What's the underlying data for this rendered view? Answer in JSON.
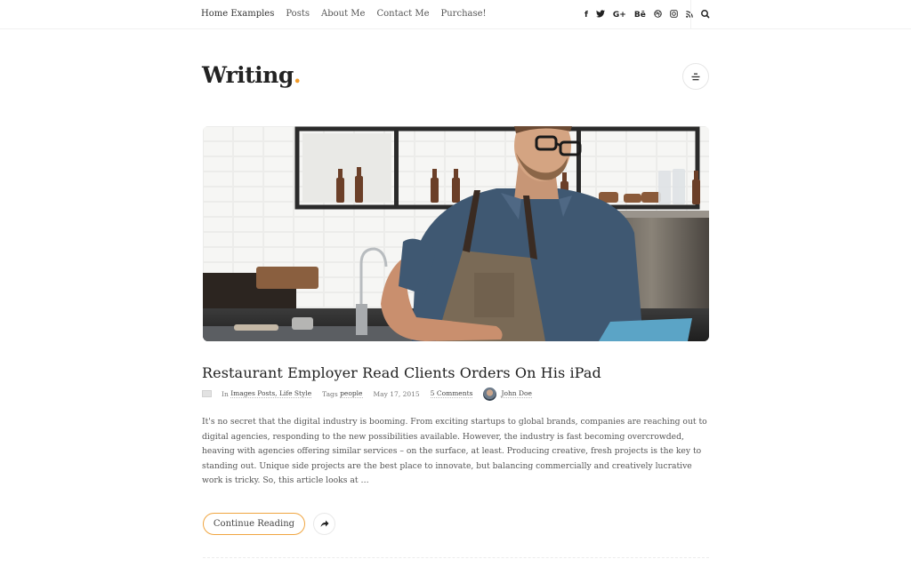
{
  "nav": {
    "items": [
      {
        "label": "Home Examples",
        "active": true
      },
      {
        "label": "Posts",
        "active": false
      },
      {
        "label": "About Me",
        "active": false
      },
      {
        "label": "Contact Me",
        "active": false
      },
      {
        "label": "Purchase!",
        "active": false
      }
    ],
    "social": [
      {
        "icon": "facebook-icon",
        "glyph": "f"
      },
      {
        "icon": "twitter-icon",
        "glyph": "🐦"
      },
      {
        "icon": "google-plus-icon",
        "glyph": "G+"
      },
      {
        "icon": "behance-icon",
        "glyph": "Bē"
      },
      {
        "icon": "dribbble-icon",
        "glyph": "◎"
      },
      {
        "icon": "instagram-icon",
        "glyph": "◙"
      },
      {
        "icon": "rss-icon",
        "glyph": "⩘"
      }
    ],
    "search_icon": "search-icon"
  },
  "header": {
    "title": "Writing",
    "title_dot": ".",
    "menu_icon": "menu-icon"
  },
  "colors": {
    "accent": "#f39c2a",
    "text": "#222222",
    "muted": "#777777"
  },
  "post": {
    "image_alt": "Man in apron reading orders on iPad in a restaurant",
    "title": "Restaurant Employer Read Clients Orders On His iPad",
    "meta": {
      "format_icon": "image-format-icon",
      "in_label": "In",
      "categories": "Images Posts, Life Style",
      "tags_label": "Tags",
      "tags": "people",
      "date": "May 17, 2015",
      "comments": "5 Comments",
      "author": "John Doe"
    },
    "excerpt": "It's no secret that the digital industry is booming. From exciting startups to global brands, companies are reaching out to digital agencies, responding to the new possibilities available. However, the industry is fast becoming overcrowded, heaving with agencies offering similar services – on the surface, at least. Producing creative, fresh projects is the key to standing out. Unique side projects are the best place to innovate, but balancing commercially and creatively lucrative work is tricky. So, this article looks at …",
    "continue_label": "Continue Reading",
    "share_icon": "share-icon"
  }
}
